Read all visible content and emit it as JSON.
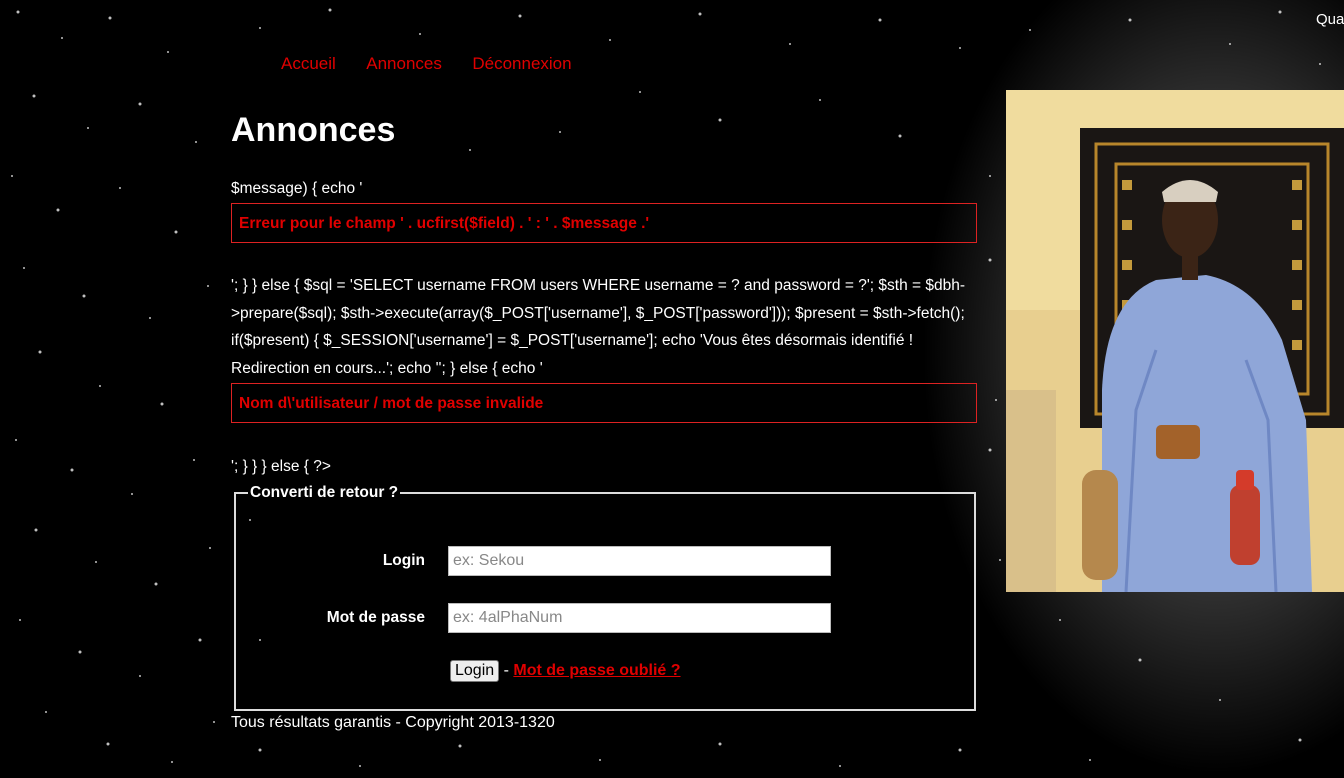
{
  "top_right": {
    "text": "Qua"
  },
  "nav": {
    "items": [
      {
        "label": "Accueil"
      },
      {
        "label": "Annonces"
      },
      {
        "label": "Déconnexion"
      }
    ]
  },
  "page": {
    "title": "Annonces",
    "code_line_1": "$message) { echo '",
    "error_1": "Erreur pour le champ ' . ucfirst($field) . ' : ' . $message .'",
    "code_block": "'; } } else { $sql = 'SELECT username FROM users WHERE username = ? and password = ?'; $sth = $dbh->prepare($sql); $sth->execute(array($_POST['username'], $_POST['password'])); $present = $sth->fetch(); if($present) { $_SESSION['username'] = $_POST['username']; echo 'Vous êtes désormais identifié ! Redirection en cours...'; echo ''; } else { echo '",
    "error_2": "Nom d\\'utilisateur / mot de passe invalide",
    "code_line_2": "'; } } } else { ?>"
  },
  "form": {
    "legend": "Converti de retour ?",
    "login_label": "Login",
    "login_placeholder": "ex: Sekou",
    "password_label": "Mot de passe",
    "password_placeholder": "ex: 4alPhaNum",
    "submit_label": "Login",
    "separator": "-",
    "forgot_label": "Mot de passe oublié ?"
  },
  "footer": {
    "text": "Tous résultats garantis - Copyright 2013-1320"
  },
  "colors": {
    "link": "#e00000",
    "background": "#000000",
    "text": "#ffffff"
  }
}
